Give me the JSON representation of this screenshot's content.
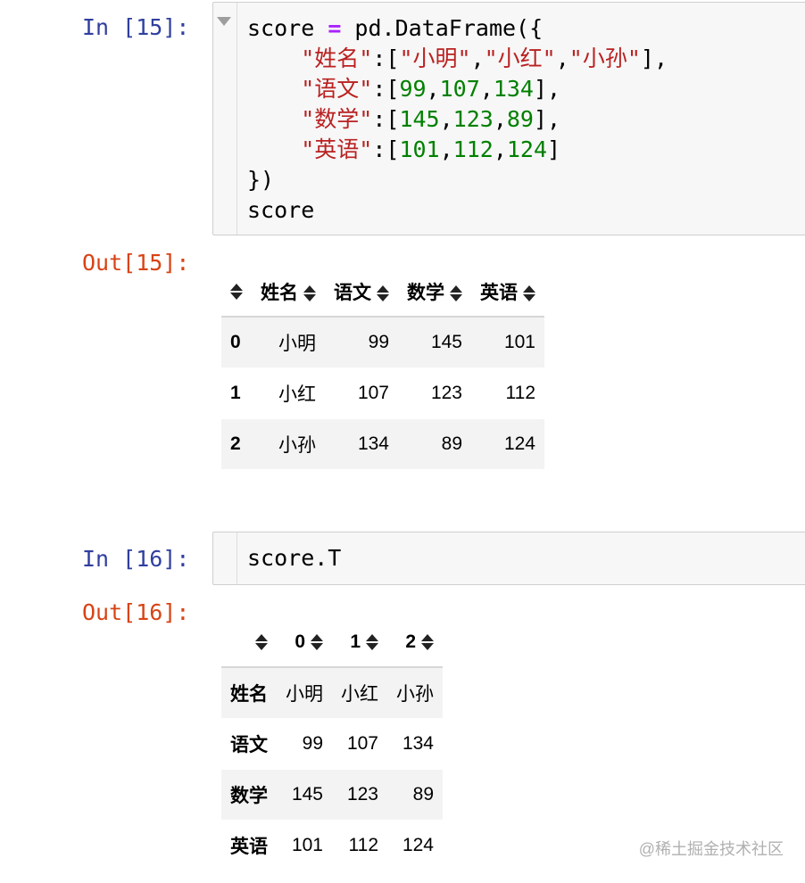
{
  "cells": [
    {
      "in_prompt": "In [15]:",
      "code_tokens": [
        [
          {
            "t": "plain",
            "v": "score "
          },
          {
            "t": "op",
            "v": "="
          },
          {
            "t": "plain",
            "v": " pd.DataFrame({"
          }
        ],
        [
          {
            "t": "plain",
            "v": "    "
          },
          {
            "t": "str",
            "v": "\"姓名\""
          },
          {
            "t": "plain",
            "v": ":["
          },
          {
            "t": "str",
            "v": "\"小明\""
          },
          {
            "t": "plain",
            "v": ","
          },
          {
            "t": "str",
            "v": "\"小红\""
          },
          {
            "t": "plain",
            "v": ","
          },
          {
            "t": "str",
            "v": "\"小孙\""
          },
          {
            "t": "plain",
            "v": "],"
          }
        ],
        [
          {
            "t": "plain",
            "v": "    "
          },
          {
            "t": "str",
            "v": "\"语文\""
          },
          {
            "t": "plain",
            "v": ":["
          },
          {
            "t": "num",
            "v": "99"
          },
          {
            "t": "plain",
            "v": ","
          },
          {
            "t": "num",
            "v": "107"
          },
          {
            "t": "plain",
            "v": ","
          },
          {
            "t": "num",
            "v": "134"
          },
          {
            "t": "plain",
            "v": "],"
          }
        ],
        [
          {
            "t": "plain",
            "v": "    "
          },
          {
            "t": "str",
            "v": "\"数学\""
          },
          {
            "t": "plain",
            "v": ":["
          },
          {
            "t": "num",
            "v": "145"
          },
          {
            "t": "plain",
            "v": ","
          },
          {
            "t": "num",
            "v": "123"
          },
          {
            "t": "plain",
            "v": ","
          },
          {
            "t": "num",
            "v": "89"
          },
          {
            "t": "plain",
            "v": "],"
          }
        ],
        [
          {
            "t": "plain",
            "v": "    "
          },
          {
            "t": "str",
            "v": "\"英语\""
          },
          {
            "t": "plain",
            "v": ":["
          },
          {
            "t": "num",
            "v": "101"
          },
          {
            "t": "plain",
            "v": ","
          },
          {
            "t": "num",
            "v": "112"
          },
          {
            "t": "plain",
            "v": ","
          },
          {
            "t": "num",
            "v": "124"
          },
          {
            "t": "plain",
            "v": "]"
          }
        ],
        [
          {
            "t": "plain",
            "v": "})"
          }
        ],
        [
          {
            "t": "plain",
            "v": "score"
          }
        ]
      ],
      "out_prompt": "Out[15]:",
      "table": {
        "columns": [
          "姓名",
          "语文",
          "数学",
          "英语"
        ],
        "rows": [
          {
            "index": "0",
            "cells": [
              "小明",
              "99",
              "145",
              "101"
            ]
          },
          {
            "index": "1",
            "cells": [
              "小红",
              "107",
              "123",
              "112"
            ]
          },
          {
            "index": "2",
            "cells": [
              "小孙",
              "134",
              "89",
              "124"
            ]
          }
        ]
      }
    },
    {
      "in_prompt": "In [16]:",
      "code_tokens": [
        [
          {
            "t": "plain",
            "v": "score.T"
          }
        ]
      ],
      "out_prompt": "Out[16]:",
      "table": {
        "columns": [
          "0",
          "1",
          "2"
        ],
        "rows": [
          {
            "index": "姓名",
            "cells": [
              "小明",
              "小红",
              "小孙"
            ]
          },
          {
            "index": "语文",
            "cells": [
              "99",
              "107",
              "134"
            ]
          },
          {
            "index": "数学",
            "cells": [
              "145",
              "123",
              "89"
            ]
          },
          {
            "index": "英语",
            "cells": [
              "101",
              "112",
              "124"
            ]
          }
        ]
      }
    }
  ],
  "watermark": "@稀土掘金技术社区",
  "icons": {
    "collapse": "caret-down-icon",
    "sort": "sort-icon"
  },
  "colors": {
    "in_prompt": "#303f9f",
    "out_prompt": "#d84315",
    "string": "#ba2121",
    "number": "#008000",
    "operator": "#aa22ff"
  }
}
